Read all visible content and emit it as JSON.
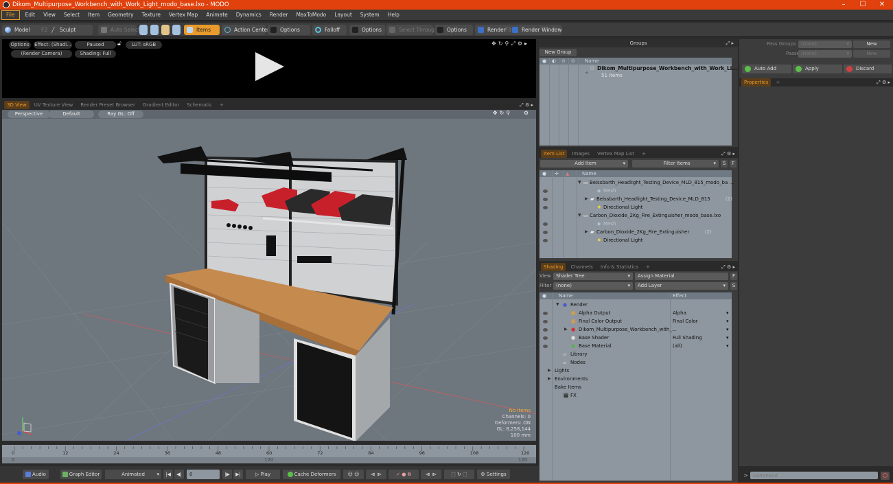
{
  "window": {
    "title": "Dikom_Multipurpose_Workbench_with_Work_Light_modo_base.lxo - MODO",
    "controls": {
      "minimize": "–",
      "maximize": "☐",
      "close": "✕"
    }
  },
  "menu": [
    "File",
    "Edit",
    "View",
    "Select",
    "Item",
    "Geometry",
    "Texture",
    "Vertex Map",
    "Animate",
    "Dynamics",
    "Render",
    "MaxToModo",
    "Layout",
    "System",
    "Help"
  ],
  "toolbar": {
    "model": "Model",
    "model_key": "F2",
    "sculpt": "Sculpt",
    "auto_select": "Auto Select",
    "items": "Items",
    "action_center": "Action Center",
    "options1": "Options",
    "falloff": "Falloff",
    "options2": "Options",
    "select_through": "Select Through",
    "options3": "Options",
    "render": "Render",
    "render_key": "F9",
    "render_window": "Render Window"
  },
  "preview": {
    "options": "Options",
    "effect": "Effect: (Shadi...",
    "paused": "Paused",
    "lut": "LUT: sRGB",
    "camera": "(Render Camera)",
    "shading": "Shading: Full"
  },
  "viewport_tabs": [
    "3D View",
    "UV Texture View",
    "Render Preset Browser",
    "Gradient Editor",
    "Schematic",
    "+"
  ],
  "viewport": {
    "perspective": "Perspective",
    "default": "Default",
    "raygl": "Ray GL: Off",
    "hud": {
      "no_items": "No Items",
      "channels": "Channels: 0",
      "deformers": "Deformers: ON",
      "gl": "GL: 8,258,144",
      "scale": "100 mm"
    }
  },
  "groups": {
    "title": "Groups",
    "new_group": "New Group",
    "col_name": "Name",
    "item_name": "Dikom_Multipurpose_Workbench_with_Work_Li...",
    "item_count": "51 Items"
  },
  "passes": {
    "pass_groups_label": "Pass Groups",
    "pass_groups_value": "(none)",
    "passes_label": "Passes",
    "passes_value": "(none)",
    "new1": "New",
    "new2": "New",
    "auto_add": "Auto Add",
    "apply": "Apply",
    "discard": "Discard",
    "properties_tab": "Properties",
    "plus": "+"
  },
  "item_list": {
    "tabs": [
      "Item List",
      "Images",
      "Vertex Map List",
      "+"
    ],
    "add_item": "Add Item",
    "filter_items": "Filter Items",
    "s": "S",
    "f": "F",
    "col_name": "Name",
    "rows": [
      {
        "label": "Beissbarth_Headlight_Testing_Device_MLD_815_modo_ba ...",
        "indent": 0,
        "dim": false,
        "expander": "▼"
      },
      {
        "label": "Mesh",
        "indent": 2,
        "dim": true,
        "expander": ""
      },
      {
        "label": "Beissbarth_Headlight_Testing_Device_MLD_815",
        "count": "(2)",
        "indent": 1,
        "dim": false,
        "expander": "▶"
      },
      {
        "label": "Directional Light",
        "indent": 2,
        "dim": false,
        "expander": ""
      },
      {
        "label": "Carbon_Dioxide_2Kg_Fire_Extinguisher_modo_base.lxo",
        "indent": 0,
        "dim": false,
        "expander": "▼"
      },
      {
        "label": "Mesh",
        "indent": 2,
        "dim": true,
        "expander": ""
      },
      {
        "label": "Carbon_Dioxide_2Kg_Fire_Extinguisher",
        "count": "(2)",
        "indent": 1,
        "dim": false,
        "expander": "▶"
      },
      {
        "label": "Directional Light",
        "indent": 2,
        "dim": false,
        "expander": ""
      }
    ]
  },
  "shading": {
    "tabs": [
      "Shading",
      "Channels",
      "Info & Statistics",
      "+"
    ],
    "view_label": "View",
    "view_value": "Shader Tree",
    "assign_material": "Assign Material",
    "f": "F",
    "filter_label": "Filter",
    "filter_value": "(none)",
    "add_layer": "Add Layer",
    "s": "S",
    "col_name": "Name",
    "col_effect": "Effect",
    "rows": [
      {
        "label": "Render",
        "effect": "",
        "indent": 0,
        "icon": "render-sphere",
        "expander": "▼"
      },
      {
        "label": "Alpha Output",
        "effect": "Alpha",
        "indent": 1,
        "icon": "output"
      },
      {
        "label": "Final Color Output",
        "effect": "Final Color",
        "indent": 1,
        "icon": "output"
      },
      {
        "label": "Dikom_Multipurpose_Workbench_with_...",
        "effect": "",
        "indent": 1,
        "icon": "material-group",
        "expander": "▶"
      },
      {
        "label": "Base Shader",
        "effect": "Full Shading",
        "indent": 1,
        "icon": "shader"
      },
      {
        "label": "Base Material",
        "effect": "(all)",
        "indent": 1,
        "icon": "material"
      },
      {
        "label": "Library",
        "indent": 0,
        "icon": "folder"
      },
      {
        "label": "Nodes",
        "indent": 0,
        "icon": "folder"
      },
      {
        "label": "Lights",
        "indent": -1,
        "expander": "▶"
      },
      {
        "label": "Environments",
        "indent": -1,
        "expander": "▶"
      },
      {
        "label": "Bake Items",
        "indent": -1
      },
      {
        "label": "FX",
        "indent": 0,
        "icon": "fx"
      }
    ]
  },
  "timeline": {
    "ticks": [
      "0",
      "12",
      "24",
      "36",
      "48",
      "60",
      "72",
      "84",
      "96",
      "108",
      "120"
    ],
    "range_start": "0",
    "range_mid": "120",
    "range_end": "120"
  },
  "transport": {
    "audio": "Audio",
    "graph_editor": "Graph Editor",
    "animated": "Animated",
    "frame": "0",
    "play": "Play",
    "cache_deformers": "Cache Deformers",
    "settings": "Settings"
  },
  "command": {
    "prompt": ">",
    "placeholder": "Command"
  },
  "colors": {
    "accent": "#e89a2c",
    "titlebar": "#e0410d",
    "list_bg": "#8e979f",
    "viewport_bg": "#6e767e"
  }
}
